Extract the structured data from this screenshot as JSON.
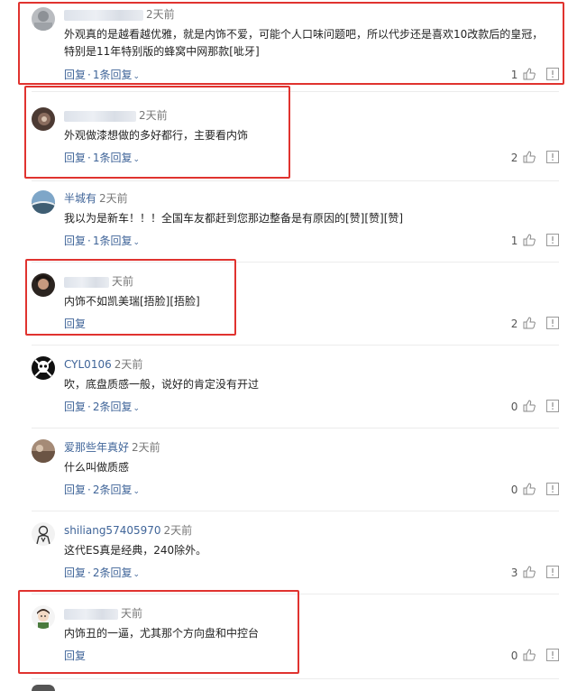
{
  "labels": {
    "reply": "回复",
    "dot": "·"
  },
  "comments": [
    {
      "user": "",
      "time": "2天前",
      "text": "外观真的是越看越优雅，就是内饰不爱，可能个人口味问题吧，所以代步还是喜欢10改款后的皇冠，特别是11年特别版的蜂窝中网那款[呲牙]",
      "replies": "1条回复",
      "likes": "1"
    },
    {
      "user": "",
      "time": "2天前",
      "text": "外观做漆想做的多好都行，主要看内饰",
      "replies": "1条回复",
      "likes": "2"
    },
    {
      "user": "半城有",
      "time": "2天前",
      "text": "我以为是新车！！！全国车友都赶到您那边整备是有原因的[赞][赞][赞]",
      "replies": "1条回复",
      "likes": "1"
    },
    {
      "user": "",
      "time": "天前",
      "text": "内饰不如凯美瑞[捂脸][捂脸]",
      "replies": "",
      "likes": "2"
    },
    {
      "user": "CYL0106",
      "time": "2天前",
      "text": "吹，底盘质感一般，说好的肯定没有开过",
      "replies": "2条回复",
      "likes": "0"
    },
    {
      "user": "爱那些年真好",
      "time": "2天前",
      "text": "什么叫做质感",
      "replies": "2条回复",
      "likes": "0"
    },
    {
      "user": "shiliang57405970",
      "time": "2天前",
      "text": "这代ES真是经典，240除外。",
      "replies": "2条回复",
      "likes": "3"
    },
    {
      "user": "",
      "time": "天前",
      "text": "内饰丑的一逼，尤其那个方向盘和中控台",
      "replies": "",
      "likes": "0"
    }
  ]
}
